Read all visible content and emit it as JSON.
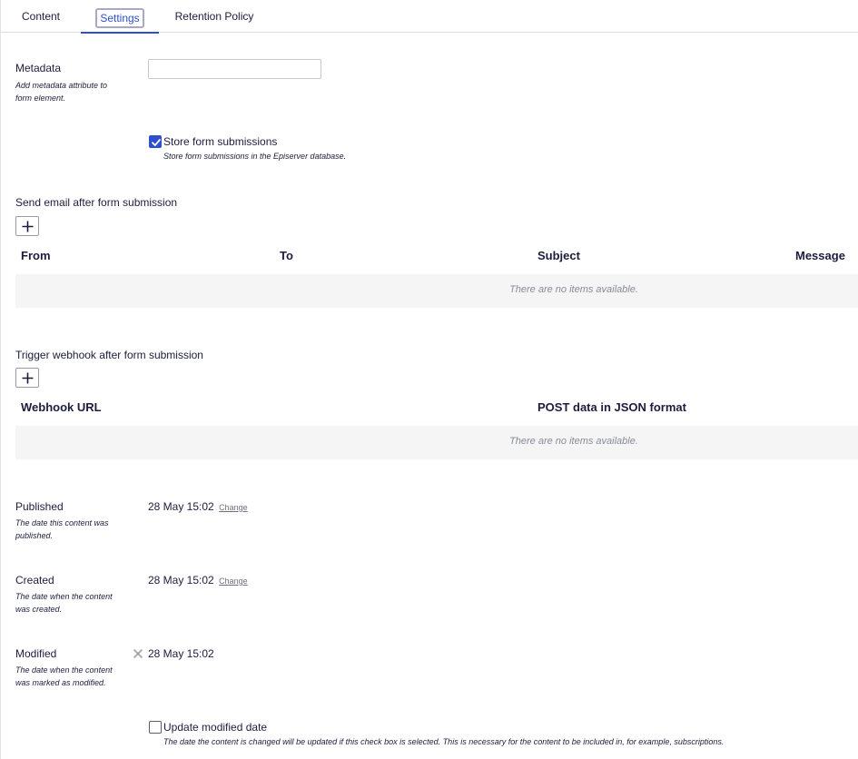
{
  "tabs": [
    {
      "label": "Content"
    },
    {
      "label": "Settings"
    },
    {
      "label": "Retention Policy"
    }
  ],
  "metadata": {
    "label": "Metadata",
    "help": "Add metadata attribute to form element.",
    "value": ""
  },
  "store_submissions": {
    "label": "Store form submissions",
    "help": "Store form submissions in the Episerver database.",
    "checked": true
  },
  "email_section": {
    "title": "Send email after form submission",
    "columns": [
      "From",
      "To",
      "Subject",
      "Message"
    ],
    "empty_text": "There are no items available."
  },
  "webhook_section": {
    "title": "Trigger webhook after form submission",
    "columns": [
      "Webhook URL",
      "POST data in JSON format"
    ],
    "empty_text": "There are no items available."
  },
  "published": {
    "label": "Published",
    "help": "The date this content was published.",
    "value": "28 May 15:02",
    "link": "Change"
  },
  "created": {
    "label": "Created",
    "help": "The date when the content was created.",
    "value": "28 May 15:02",
    "link": "Change"
  },
  "modified": {
    "label": "Modified",
    "help": "The date when the content was marked as modified.",
    "value": "28 May 15:02"
  },
  "update_modified": {
    "label": "Update modified date",
    "help": "The date the content is changed will be updated if this check box is selected. This is necessary for the content to be included in, for example, subscriptions.",
    "checked": false
  },
  "colors": {
    "accent": "#2f4fd1",
    "text": "#1c1d3d",
    "empty_row": "#f5f5f5"
  }
}
